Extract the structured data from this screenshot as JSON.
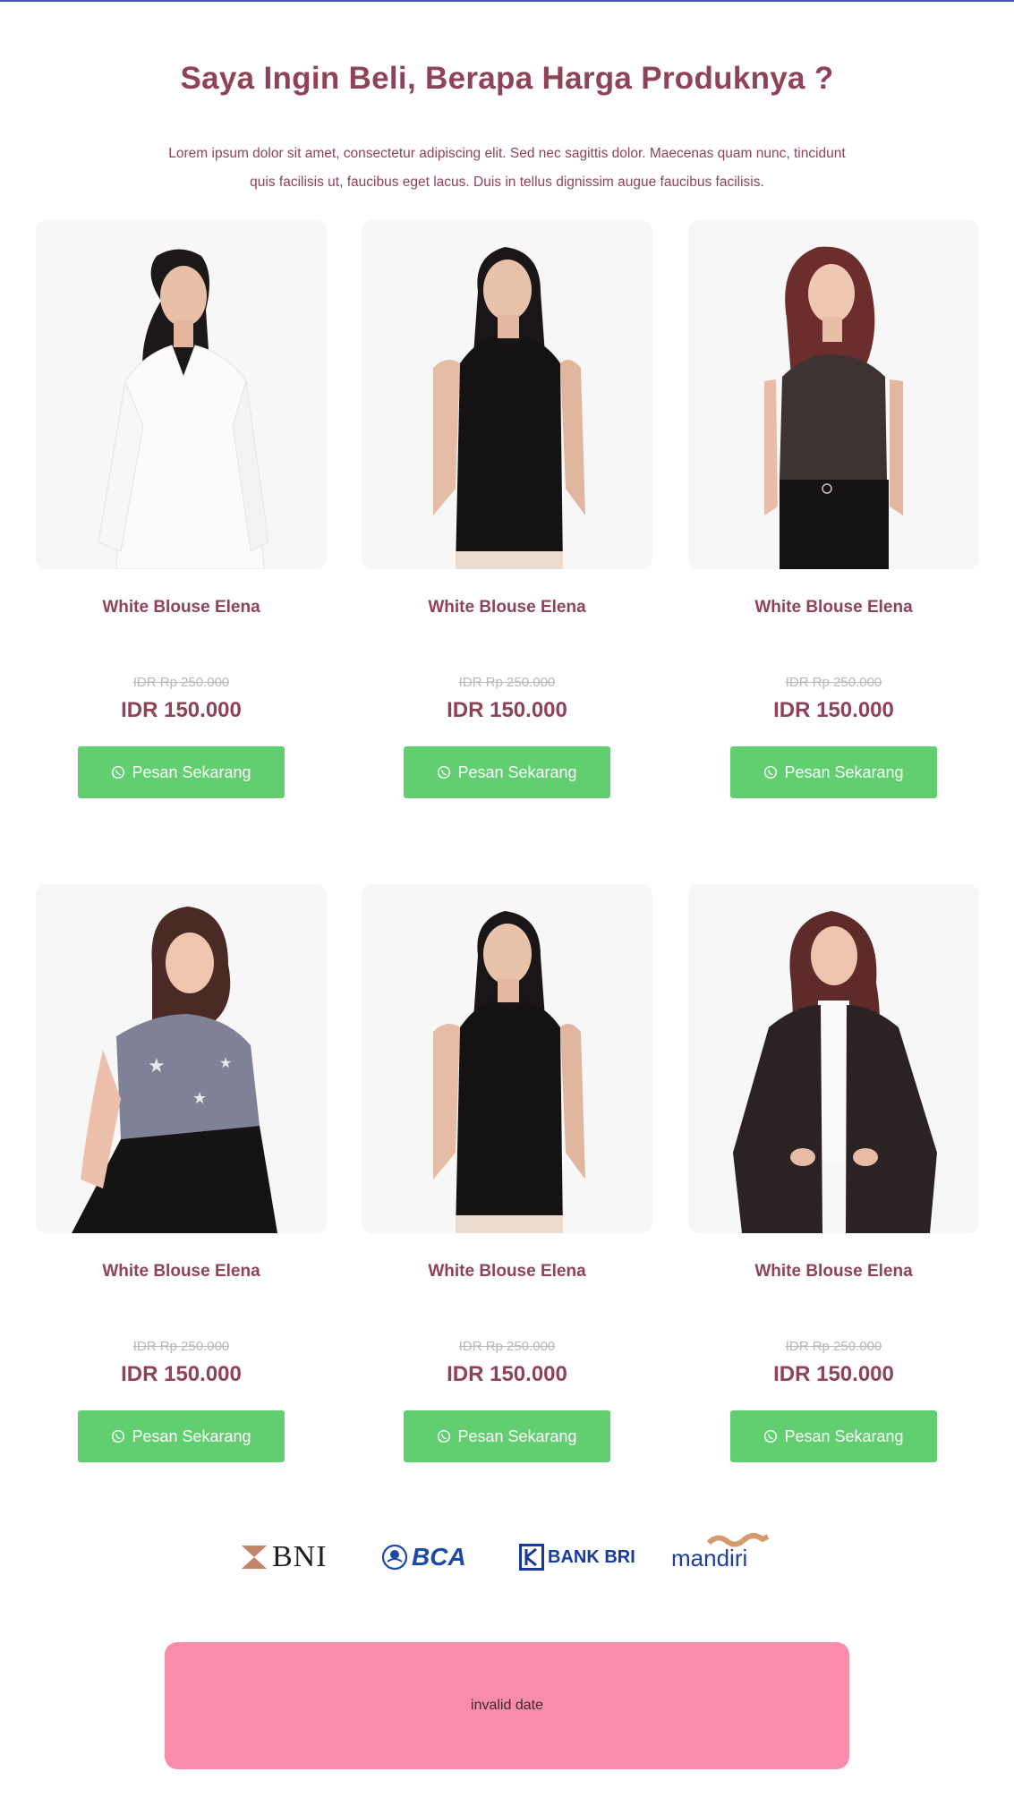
{
  "hero": {
    "title": "Saya Ingin Beli, Berapa Harga Produknya ?",
    "description": "Lorem ipsum dolor sit amet, consectetur adipiscing elit. Sed nec sagittis dolor. Maecenas quam nunc, tincidunt quis facilisis ut, faucibus eget lacus. Duis in tellus dignissim augue faucibus facilisis."
  },
  "products": [
    {
      "name": "White Blouse Elena",
      "old_price": "IDR Rp 250.000",
      "price": "IDR 150.000",
      "button": "Pesan Sekarang"
    },
    {
      "name": "White Blouse Elena",
      "old_price": "IDR Rp 250.000",
      "price": "IDR 150.000",
      "button": "Pesan Sekarang"
    },
    {
      "name": "White Blouse Elena",
      "old_price": "IDR Rp 250.000",
      "price": "IDR 150.000",
      "button": "Pesan Sekarang"
    },
    {
      "name": "White Blouse Elena",
      "old_price": "IDR Rp 250.000",
      "price": "IDR 150.000",
      "button": "Pesan Sekarang"
    },
    {
      "name": "White Blouse Elena",
      "old_price": "IDR Rp 250.000",
      "price": "IDR 150.000",
      "button": "Pesan Sekarang"
    },
    {
      "name": "White Blouse Elena",
      "old_price": "IDR Rp 250.000",
      "price": "IDR 150.000",
      "button": "Pesan Sekarang"
    }
  ],
  "banks": {
    "bni": "BNI",
    "bca": "BCA",
    "bri": "BANK BRI",
    "mandiri": "mandiri"
  },
  "countdown": {
    "text": "invalid date"
  },
  "colors": {
    "accent": "#8e4356",
    "button": "#61ce70",
    "countdown_bg": "#f78dab",
    "top_border": "#4a5aa8"
  }
}
